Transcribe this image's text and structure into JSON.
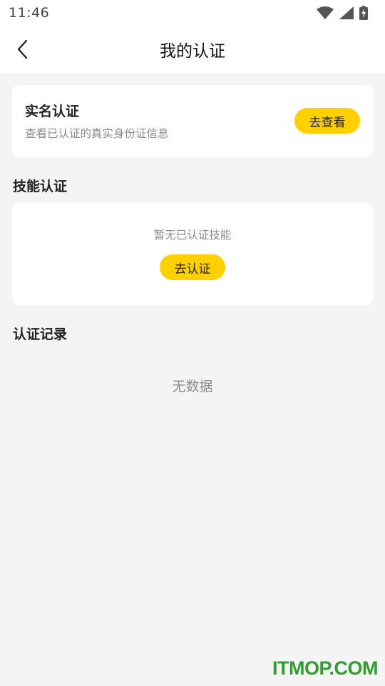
{
  "status_bar": {
    "time": "11:46",
    "icons": [
      "wifi-icon",
      "signal-icon",
      "battery-charging-icon"
    ]
  },
  "nav": {
    "title": "我的认证",
    "back_icon": "chevron-left-icon"
  },
  "realname": {
    "title": "实名认证",
    "description": "查看已认证的真实身份证信息",
    "button_label": "去查看"
  },
  "skill": {
    "section_title": "技能认证",
    "empty_text": "暂无已认证技能",
    "button_label": "去认证"
  },
  "record": {
    "section_title": "认证记录",
    "empty_text": "无数据"
  },
  "watermark": "ITMOP.COM",
  "colors": {
    "accent": "#ffd000",
    "background": "#f4f4f4",
    "watermark": "#2f9e2f"
  }
}
